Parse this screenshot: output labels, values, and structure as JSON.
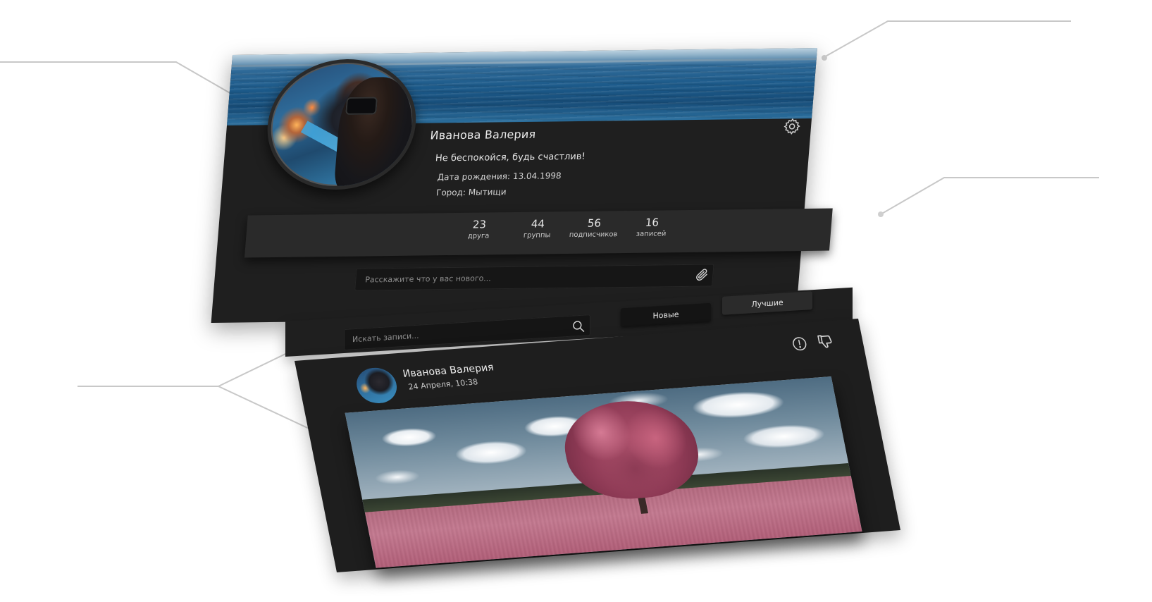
{
  "profile": {
    "name": "Иванова Валерия",
    "status": "Не беспокойся, будь счастлив!",
    "birth_date": "Дата рождения: 13.04.1998",
    "city": "Город: Мытищи",
    "settings_icon": "gear-icon"
  },
  "stats": [
    {
      "value": "23",
      "label": "друга"
    },
    {
      "value": "44",
      "label": "группы"
    },
    {
      "value": "56",
      "label": "подписчиков"
    },
    {
      "value": "16",
      "label": "записей"
    }
  ],
  "composer": {
    "placeholder": "Расскажите что у вас нового...",
    "attach_icon": "paperclip-icon"
  },
  "feed_controls": {
    "search_placeholder": "Искать записи...",
    "search_icon": "search-icon",
    "filters": [
      "Новые",
      "Лучшие"
    ]
  },
  "post": {
    "author": "Иванова Валерия",
    "date": "24 Апреля, 10:38",
    "report_icon": "exclamation-circle-icon",
    "dislike_icon": "thumbs-down-icon"
  },
  "colors": {
    "panel": "#1f1f1f",
    "stats_bar": "#2a2a2a",
    "input_bg": "#161616",
    "text": "#eaeaea"
  }
}
